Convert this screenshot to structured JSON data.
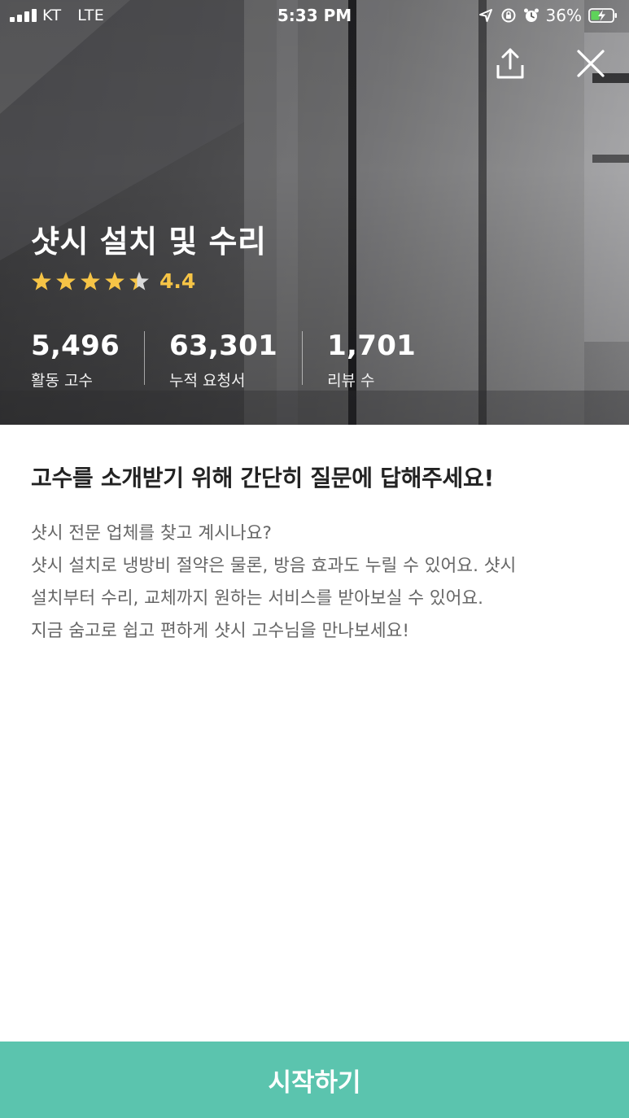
{
  "status_bar": {
    "carrier": "KT",
    "network": "LTE",
    "time": "5:33 PM",
    "battery": "36%"
  },
  "header": {
    "share_icon": "share-icon",
    "close_icon": "close-icon"
  },
  "service": {
    "title": "샷시 설치 및 수리",
    "rating": "4.4",
    "rating_value": 4.4,
    "rating_max": 5
  },
  "stats": [
    {
      "value": "5,496",
      "label": "활동 고수"
    },
    {
      "value": "63,301",
      "label": "누적 요청서"
    },
    {
      "value": "1,701",
      "label": "리뷰 수"
    }
  ],
  "content": {
    "heading": "고수를 소개받기 위해 간단히 질문에 답해주세요!",
    "lines": [
      "샷시 전문 업체를 찾고 계시나요?",
      "샷시 설치로 냉방비 절약은 물론, 방음 효과도 누릴 수 있어요. 샷시",
      "설치부터 수리, 교체까지 원하는 서비스를 받아보실 수 있어요.",
      "지금 숨고로 쉽고 편하게 샷시 고수님을 만나보세요!"
    ]
  },
  "cta": {
    "label": "시작하기"
  },
  "colors": {
    "accent": "#5bc4ae",
    "star": "#f6c446"
  }
}
